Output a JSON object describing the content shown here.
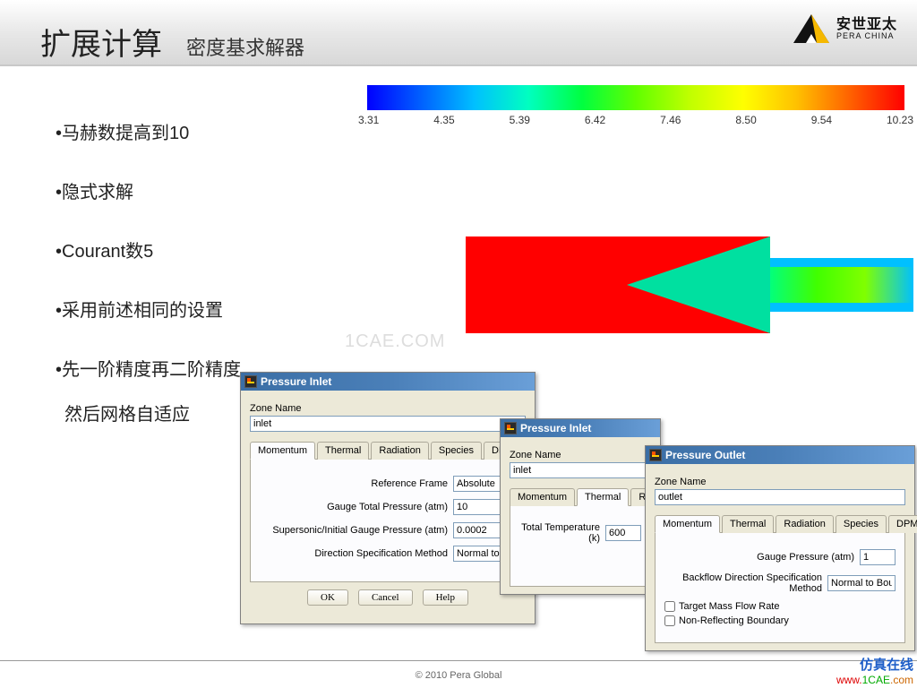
{
  "header": {
    "title_main": "扩展计算",
    "title_sub": "密度基求解器",
    "logo_cn": "安世亚太",
    "logo_en": "PERA CHINA"
  },
  "bullets": {
    "b1": "•马赫数提高到10",
    "b2": "•隐式求解",
    "b3": "•Courant数5",
    "b4": "•采用前述相同的设置",
    "b5": "•先一阶精度再二阶精度",
    "b5_after": "然后网格自适应"
  },
  "legend": {
    "ticks": [
      "3.31",
      "4.35",
      "5.39",
      "6.42",
      "7.46",
      "8.50",
      "9.54",
      "10.23"
    ]
  },
  "watermark": "1CAE.COM",
  "dlg1": {
    "title": "Pressure Inlet",
    "zone_label": "Zone Name",
    "zone_value": "inlet",
    "tabs": {
      "t1": "Momentum",
      "t2": "Thermal",
      "t3": "Radiation",
      "t4": "Species",
      "t5": "DPM"
    },
    "ref_frame_label": "Reference Frame",
    "ref_frame_value": "Absolute",
    "gauge_total_label": "Gauge Total Pressure (atm)",
    "gauge_total_value": "10",
    "supersonic_label": "Supersonic/Initial Gauge Pressure (atm)",
    "supersonic_value": "0.0002",
    "dir_label": "Direction Specification Method",
    "dir_value": "Normal to",
    "ok": "OK",
    "cancel": "Cancel",
    "help": "Help"
  },
  "dlg2": {
    "title": "Pressure Inlet",
    "zone_label": "Zone Name",
    "zone_value": "inlet",
    "tabs": {
      "t1": "Momentum",
      "t2": "Thermal",
      "t3": "Radiati"
    },
    "total_temp_label": "Total Temperature (k)",
    "total_temp_value": "600"
  },
  "dlg3": {
    "title": "Pressure Outlet",
    "zone_label": "Zone Name",
    "zone_value": "outlet",
    "tabs": {
      "t1": "Momentum",
      "t2": "Thermal",
      "t3": "Radiation",
      "t4": "Species",
      "t5": "DPM"
    },
    "gauge_label": "Gauge Pressure (atm)",
    "gauge_value": "1",
    "backflow_label": "Backflow Direction Specification Method",
    "backflow_value": "Normal to Bou",
    "chk1": "Target Mass Flow Rate",
    "chk2": "Non-Reflecting Boundary"
  },
  "footer": {
    "copyright": "© 2010 Pera Global",
    "badge_cn": "仿真在线",
    "badge_url_w": "www.",
    "badge_url_c": "1CAE",
    "badge_url_m": ".com"
  }
}
